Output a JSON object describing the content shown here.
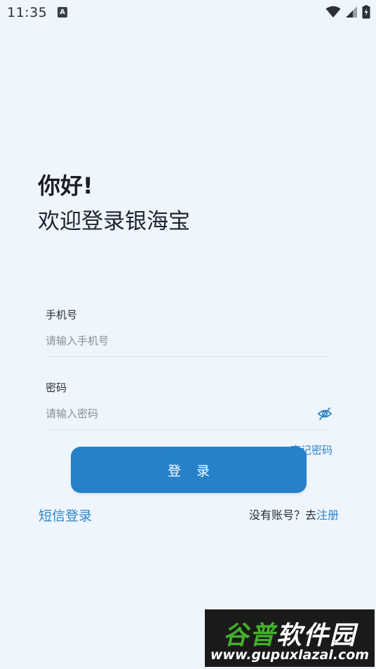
{
  "status_bar": {
    "time": "11:35",
    "notification_icon": "A"
  },
  "greeting": {
    "hello": "你好!",
    "welcome": "欢迎登录银海宝"
  },
  "form": {
    "phone_label": "手机号",
    "phone_placeholder": "请输入手机号",
    "password_label": "密码",
    "password_placeholder": "请输入密码",
    "forgot_password": "忘记密码",
    "login_button": "登 录"
  },
  "footer": {
    "sms_login": "短信登录",
    "no_account": "没有账号？去",
    "register": "注册"
  },
  "watermark": {
    "title_part1": "谷普",
    "title_part2": "软件园",
    "url": "www.gupuxlazal.com"
  },
  "colors": {
    "background": "#eef5fc",
    "accent": "#2581c8",
    "link": "#2e84c9"
  },
  "icons": {
    "eye": "eye-slash-icon",
    "wifi": "wifi-icon",
    "signal": "signal-icon",
    "battery": "battery-charging-icon"
  }
}
